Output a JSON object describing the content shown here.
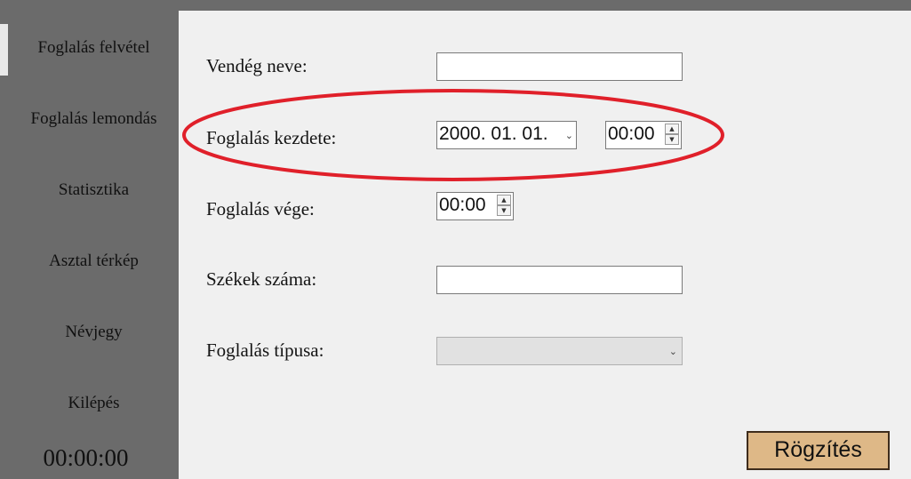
{
  "sidebar": {
    "items": [
      {
        "label": "Foglalás felvétel"
      },
      {
        "label": "Foglalás lemondás"
      },
      {
        "label": "Statisztika"
      },
      {
        "label": "Asztal térkép"
      },
      {
        "label": "Névjegy"
      },
      {
        "label": "Kilépés"
      }
    ],
    "clock": "00:00:00"
  },
  "form": {
    "guest_name_label": "Vendég neve:",
    "guest_name_value": "",
    "start_label": "Foglalás kezdete:",
    "start_date": "2000. 01. 01.",
    "start_time": "00:00",
    "end_label": "Foglalás vége:",
    "end_time": "00:00",
    "seats_label": "Székek száma:",
    "seats_value": "",
    "type_label": "Foglalás típusa:",
    "type_value": "",
    "submit_label": "Rögzítés"
  },
  "colors": {
    "sidebar": "#6b6b6b",
    "content": "#f0f0f0",
    "submit_button": "#deb887",
    "highlight_ellipse": "#e0202a"
  }
}
